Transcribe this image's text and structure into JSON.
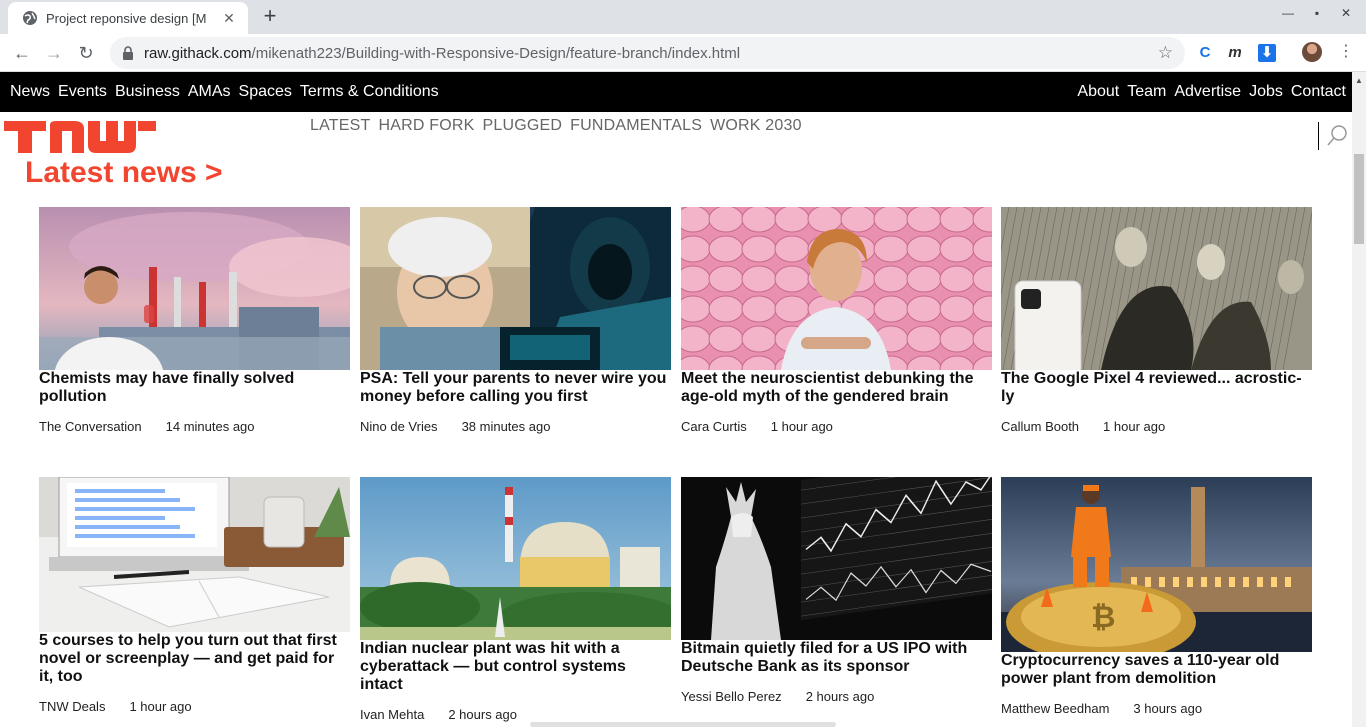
{
  "browser": {
    "tab_title": "Project reponsive design [M",
    "url_host": "raw.githack.com",
    "url_path": "/mikenath223/Building-with-Responsive-Design/feature-branch/index.html"
  },
  "site_nav": {
    "left": [
      "News",
      "Events",
      "Business",
      "AMAs",
      "Spaces",
      "Terms & Conditions"
    ],
    "right": [
      "About",
      "Team",
      "Advertise",
      "Jobs",
      "Contact"
    ]
  },
  "logo": {
    "text": "TNW",
    "color": "#f2452f"
  },
  "sub_nav": [
    "LATEST",
    "HARD FORK",
    "PLUGGED",
    "FUNDAMENTALS",
    "WORK 2030"
  ],
  "headline": "Latest news >",
  "accent_color": "#f2452f",
  "articles": [
    {
      "title": "Chemists may have finally solved pollution",
      "author": "The Conversation",
      "time": "14 minutes ago",
      "image": "scientist-factory-smoke"
    },
    {
      "title": "PSA: Tell your parents to never wire you money before calling you first",
      "author": "Nino de Vries",
      "time": "38 minutes ago",
      "image": "grandma-and-hacker"
    },
    {
      "title": "Meet the neuroscientist debunking the age-old myth of the gendered brain",
      "author": "Cara Curtis",
      "time": "1 hour ago",
      "image": "woman-pink-brains"
    },
    {
      "title": "The Google Pixel 4 reviewed... acrostic-ly",
      "author": "Callum Booth",
      "time": "1 hour ago",
      "image": "engraving-with-phone"
    },
    {
      "title": "5 courses to help you turn out that first novel or screenplay — and get paid for it, too",
      "author": "TNW Deals",
      "time": "1 hour ago",
      "image": "laptop-notebook-desk"
    },
    {
      "title": "Indian nuclear plant was hit with a cyberattack — but control systems intact",
      "author": "Ivan Mehta",
      "time": "2 hours ago",
      "image": "nuclear-plant"
    },
    {
      "title": "Bitmain quietly filed for a US IPO with Deutsche Bank as its sponsor",
      "author": "Yessi Bello Perez",
      "time": "2 hours ago",
      "image": "statue-of-liberty-chart"
    },
    {
      "title": "Cryptocurrency saves a 110-year old power plant from demolition",
      "author": "Matthew Beedham",
      "time": "3 hours ago",
      "image": "worker-on-bitcoin"
    }
  ]
}
